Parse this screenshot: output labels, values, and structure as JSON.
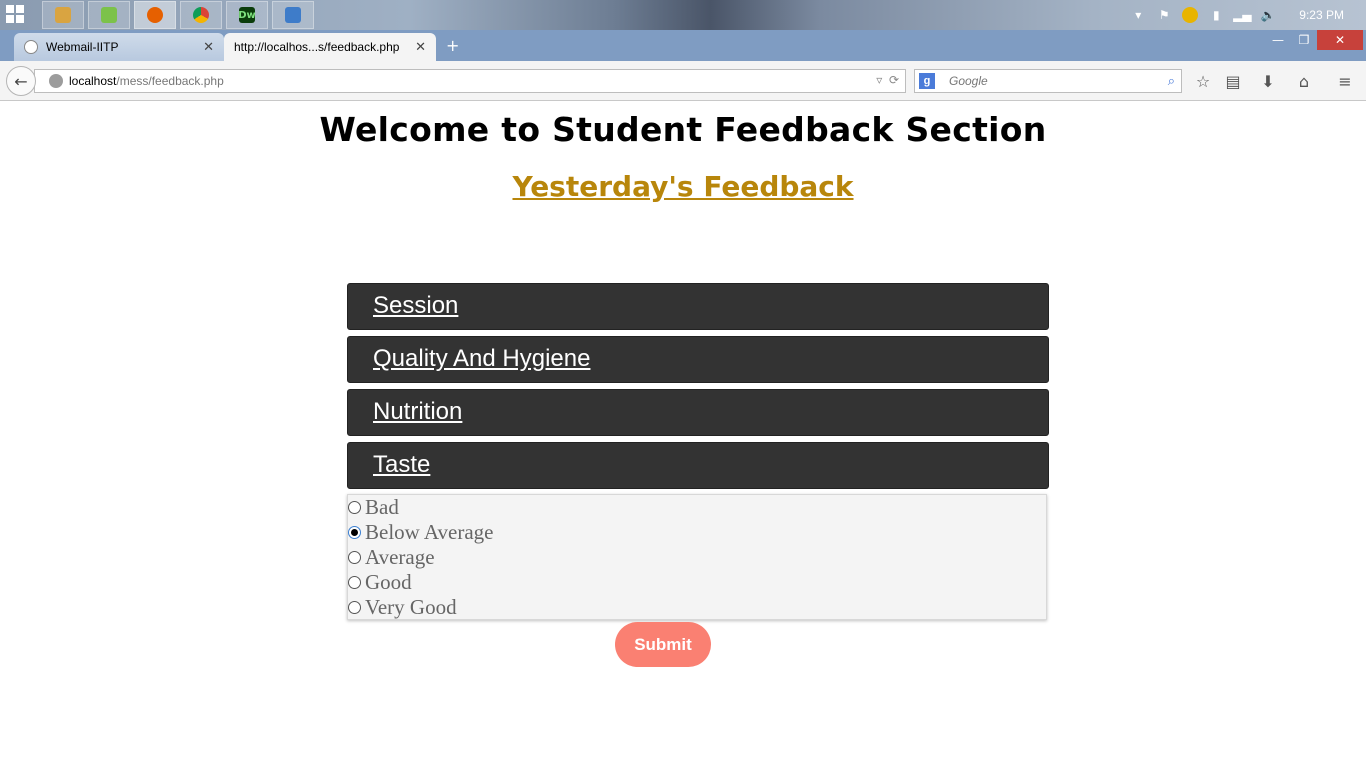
{
  "taskbar": {
    "apps": [
      {
        "name": "file-explorer-icon",
        "color": "#d9a441"
      },
      {
        "name": "messenger-icon",
        "color": "#7cc24a"
      },
      {
        "name": "firefox-icon",
        "color": "#e66000"
      },
      {
        "name": "chrome-icon",
        "color": "#2e9c43"
      },
      {
        "name": "dreamweaver-icon",
        "glyph": "Dw",
        "color": "#0b3d0b"
      },
      {
        "name": "photo-viewer-icon",
        "color": "#3e7cc9"
      }
    ],
    "clock": "9:23 PM"
  },
  "browser": {
    "tabs": [
      {
        "label": "Webmail-IITP",
        "active": false
      },
      {
        "label": "http://localhos...s/feedback.php",
        "active": true
      }
    ],
    "url_host": "localhost",
    "url_path": "/mess/feedback.php",
    "search_placeholder": "Google"
  },
  "page": {
    "title": "Welcome to Student Feedback Section",
    "subtitle": "Yesterday's Feedback",
    "sections": [
      {
        "label": "Session"
      },
      {
        "label": "Quality And Hygiene"
      },
      {
        "label": "Nutrition"
      },
      {
        "label": "Taste"
      }
    ],
    "taste_options": [
      {
        "label": "Bad",
        "checked": false
      },
      {
        "label": "Below Average",
        "checked": true
      },
      {
        "label": "Average",
        "checked": false
      },
      {
        "label": "Good",
        "checked": false
      },
      {
        "label": "Very Good",
        "checked": false
      }
    ],
    "submit_label": "Submit",
    "colors": {
      "accordion_bg": "#333333",
      "subtitle": "#b8860b",
      "submit_bg": "#fa8072"
    }
  }
}
